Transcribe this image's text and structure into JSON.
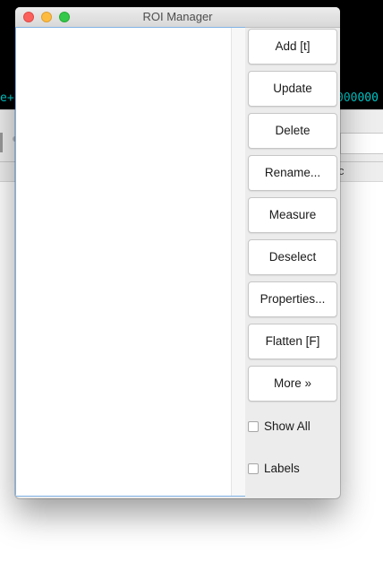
{
  "window": {
    "title": "ROI Manager"
  },
  "buttons": {
    "add": "Add [t]",
    "update": "Update",
    "delete": "Delete",
    "rename": "Rename...",
    "measure": "Measure",
    "deselect": "Deselect",
    "properties": "Properties...",
    "flatten": "Flatten [F]",
    "more": "More »"
  },
  "checkboxes": {
    "show_all": {
      "label": "Show All",
      "checked": false
    },
    "labels": {
      "label": "Labels",
      "checked": false
    }
  },
  "background_app": {
    "left_text": "e+",
    "right_text": "000000",
    "column_label": "c"
  },
  "colors": {
    "close": "#fc605c",
    "minimize": "#fdbc40",
    "zoom": "#34c84a",
    "list_focus_border": "#7fb2e6",
    "background_text": "#00c8c8"
  }
}
